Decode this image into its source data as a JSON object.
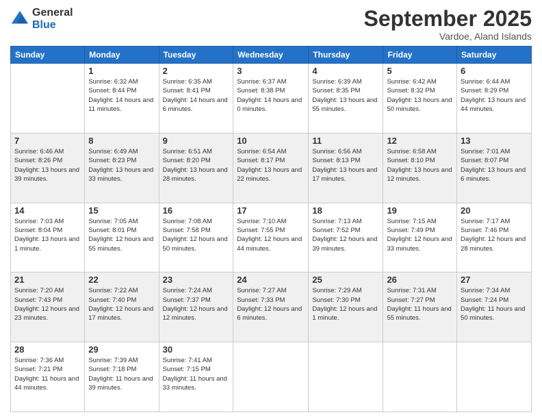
{
  "logo": {
    "general": "General",
    "blue": "Blue"
  },
  "header": {
    "month": "September 2025",
    "location": "Vardoe, Aland Islands"
  },
  "weekdays": [
    "Sunday",
    "Monday",
    "Tuesday",
    "Wednesday",
    "Thursday",
    "Friday",
    "Saturday"
  ],
  "weeks": [
    [
      {
        "day": "",
        "sunrise": "",
        "sunset": "",
        "daylight": ""
      },
      {
        "day": "1",
        "sunrise": "Sunrise: 6:32 AM",
        "sunset": "Sunset: 8:44 PM",
        "daylight": "Daylight: 14 hours and 11 minutes."
      },
      {
        "day": "2",
        "sunrise": "Sunrise: 6:35 AM",
        "sunset": "Sunset: 8:41 PM",
        "daylight": "Daylight: 14 hours and 6 minutes."
      },
      {
        "day": "3",
        "sunrise": "Sunrise: 6:37 AM",
        "sunset": "Sunset: 8:38 PM",
        "daylight": "Daylight: 14 hours and 0 minutes."
      },
      {
        "day": "4",
        "sunrise": "Sunrise: 6:39 AM",
        "sunset": "Sunset: 8:35 PM",
        "daylight": "Daylight: 13 hours and 55 minutes."
      },
      {
        "day": "5",
        "sunrise": "Sunrise: 6:42 AM",
        "sunset": "Sunset: 8:32 PM",
        "daylight": "Daylight: 13 hours and 50 minutes."
      },
      {
        "day": "6",
        "sunrise": "Sunrise: 6:44 AM",
        "sunset": "Sunset: 8:29 PM",
        "daylight": "Daylight: 13 hours and 44 minutes."
      }
    ],
    [
      {
        "day": "7",
        "sunrise": "Sunrise: 6:46 AM",
        "sunset": "Sunset: 8:26 PM",
        "daylight": "Daylight: 13 hours and 39 minutes."
      },
      {
        "day": "8",
        "sunrise": "Sunrise: 6:49 AM",
        "sunset": "Sunset: 8:23 PM",
        "daylight": "Daylight: 13 hours and 33 minutes."
      },
      {
        "day": "9",
        "sunrise": "Sunrise: 6:51 AM",
        "sunset": "Sunset: 8:20 PM",
        "daylight": "Daylight: 13 hours and 28 minutes."
      },
      {
        "day": "10",
        "sunrise": "Sunrise: 6:54 AM",
        "sunset": "Sunset: 8:17 PM",
        "daylight": "Daylight: 13 hours and 22 minutes."
      },
      {
        "day": "11",
        "sunrise": "Sunrise: 6:56 AM",
        "sunset": "Sunset: 8:13 PM",
        "daylight": "Daylight: 13 hours and 17 minutes."
      },
      {
        "day": "12",
        "sunrise": "Sunrise: 6:58 AM",
        "sunset": "Sunset: 8:10 PM",
        "daylight": "Daylight: 13 hours and 12 minutes."
      },
      {
        "day": "13",
        "sunrise": "Sunrise: 7:01 AM",
        "sunset": "Sunset: 8:07 PM",
        "daylight": "Daylight: 13 hours and 6 minutes."
      }
    ],
    [
      {
        "day": "14",
        "sunrise": "Sunrise: 7:03 AM",
        "sunset": "Sunset: 8:04 PM",
        "daylight": "Daylight: 13 hours and 1 minute."
      },
      {
        "day": "15",
        "sunrise": "Sunrise: 7:05 AM",
        "sunset": "Sunset: 8:01 PM",
        "daylight": "Daylight: 12 hours and 55 minutes."
      },
      {
        "day": "16",
        "sunrise": "Sunrise: 7:08 AM",
        "sunset": "Sunset: 7:58 PM",
        "daylight": "Daylight: 12 hours and 50 minutes."
      },
      {
        "day": "17",
        "sunrise": "Sunrise: 7:10 AM",
        "sunset": "Sunset: 7:55 PM",
        "daylight": "Daylight: 12 hours and 44 minutes."
      },
      {
        "day": "18",
        "sunrise": "Sunrise: 7:13 AM",
        "sunset": "Sunset: 7:52 PM",
        "daylight": "Daylight: 12 hours and 39 minutes."
      },
      {
        "day": "19",
        "sunrise": "Sunrise: 7:15 AM",
        "sunset": "Sunset: 7:49 PM",
        "daylight": "Daylight: 12 hours and 33 minutes."
      },
      {
        "day": "20",
        "sunrise": "Sunrise: 7:17 AM",
        "sunset": "Sunset: 7:46 PM",
        "daylight": "Daylight: 12 hours and 28 minutes."
      }
    ],
    [
      {
        "day": "21",
        "sunrise": "Sunrise: 7:20 AM",
        "sunset": "Sunset: 7:43 PM",
        "daylight": "Daylight: 12 hours and 23 minutes."
      },
      {
        "day": "22",
        "sunrise": "Sunrise: 7:22 AM",
        "sunset": "Sunset: 7:40 PM",
        "daylight": "Daylight: 12 hours and 17 minutes."
      },
      {
        "day": "23",
        "sunrise": "Sunrise: 7:24 AM",
        "sunset": "Sunset: 7:37 PM",
        "daylight": "Daylight: 12 hours and 12 minutes."
      },
      {
        "day": "24",
        "sunrise": "Sunrise: 7:27 AM",
        "sunset": "Sunset: 7:33 PM",
        "daylight": "Daylight: 12 hours and 6 minutes."
      },
      {
        "day": "25",
        "sunrise": "Sunrise: 7:29 AM",
        "sunset": "Sunset: 7:30 PM",
        "daylight": "Daylight: 12 hours and 1 minute."
      },
      {
        "day": "26",
        "sunrise": "Sunrise: 7:31 AM",
        "sunset": "Sunset: 7:27 PM",
        "daylight": "Daylight: 11 hours and 55 minutes."
      },
      {
        "day": "27",
        "sunrise": "Sunrise: 7:34 AM",
        "sunset": "Sunset: 7:24 PM",
        "daylight": "Daylight: 11 hours and 50 minutes."
      }
    ],
    [
      {
        "day": "28",
        "sunrise": "Sunrise: 7:36 AM",
        "sunset": "Sunset: 7:21 PM",
        "daylight": "Daylight: 11 hours and 44 minutes."
      },
      {
        "day": "29",
        "sunrise": "Sunrise: 7:39 AM",
        "sunset": "Sunset: 7:18 PM",
        "daylight": "Daylight: 11 hours and 39 minutes."
      },
      {
        "day": "30",
        "sunrise": "Sunrise: 7:41 AM",
        "sunset": "Sunset: 7:15 PM",
        "daylight": "Daylight: 11 hours and 33 minutes."
      },
      {
        "day": "",
        "sunrise": "",
        "sunset": "",
        "daylight": ""
      },
      {
        "day": "",
        "sunrise": "",
        "sunset": "",
        "daylight": ""
      },
      {
        "day": "",
        "sunrise": "",
        "sunset": "",
        "daylight": ""
      },
      {
        "day": "",
        "sunrise": "",
        "sunset": "",
        "daylight": ""
      }
    ]
  ]
}
